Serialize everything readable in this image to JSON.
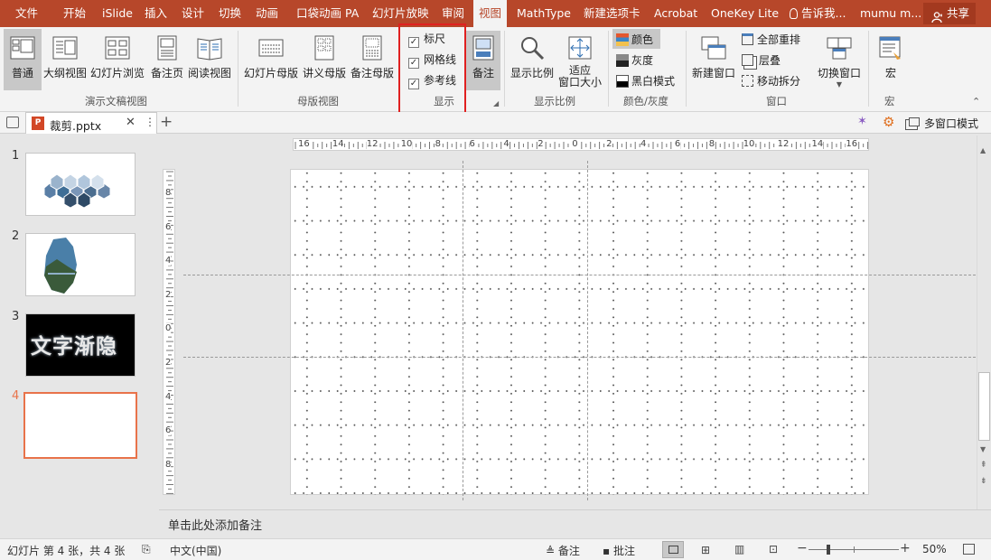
{
  "tabs": [
    "文件",
    "开始",
    "iSlide",
    "插入",
    "设计",
    "切换",
    "动画",
    "口袋动画 PA",
    "幻灯片放映",
    "审阅",
    "视图",
    "MathType",
    "新建选项卡",
    "Acrobat",
    "OneKey Lite"
  ],
  "tell_me": "告诉我...",
  "user": "mumu m...",
  "share": "共享",
  "ribbon": {
    "presentation_views": {
      "buttons": [
        "普通",
        "大纲视图",
        "幻灯片浏览",
        "备注页",
        "阅读视图"
      ],
      "label": "演示文稿视图"
    },
    "master_views": {
      "buttons": [
        "幻灯片母版",
        "讲义母版",
        "备注母版"
      ],
      "label": "母版视图"
    },
    "show": {
      "options": [
        {
          "label": "标尺",
          "checked": true
        },
        {
          "label": "网格线",
          "checked": true
        },
        {
          "label": "参考线",
          "checked": true
        }
      ],
      "notes": "备注",
      "label": "显示"
    },
    "zoom": {
      "buttons": [
        "显示比例"
      ],
      "fit_line1": "适应",
      "fit_line2": "窗口大小",
      "label": "显示比例"
    },
    "color": {
      "options": [
        "颜色",
        "灰度",
        "黑白模式"
      ],
      "label": "颜色/灰度"
    },
    "window": {
      "new_window": "新建窗口",
      "options": [
        "全部重排",
        "层叠",
        "移动拆分"
      ],
      "switch": "切换窗口",
      "label": "窗口"
    },
    "macro": {
      "button": "宏",
      "label": "宏"
    }
  },
  "doc_tab": {
    "name": "裁剪.pptx"
  },
  "multi_window": "多窗口模式",
  "slides": [
    {
      "num": "1"
    },
    {
      "num": "2"
    },
    {
      "num": "3",
      "text": "文字渐隐"
    },
    {
      "num": "4"
    }
  ],
  "hruler_labels": [
    "16",
    "14",
    "12",
    "10",
    "8",
    "6",
    "4",
    "2",
    "0",
    "2",
    "4",
    "6",
    "8",
    "10",
    "12",
    "14",
    "16"
  ],
  "vruler_labels": [
    "8",
    "6",
    "4",
    "2",
    "0",
    "2",
    "4",
    "6",
    "8"
  ],
  "notes_placeholder": "单击此处添加备注",
  "status": {
    "slide_info": "幻灯片 第 4 张，共 4 张",
    "language": "中文(中国)",
    "notes": "备注",
    "comments": "批注",
    "zoom": "50%"
  },
  "colors": {
    "accent": "#b7472a",
    "selected_thumb": "#e8734a",
    "highlight": "#e02020"
  }
}
